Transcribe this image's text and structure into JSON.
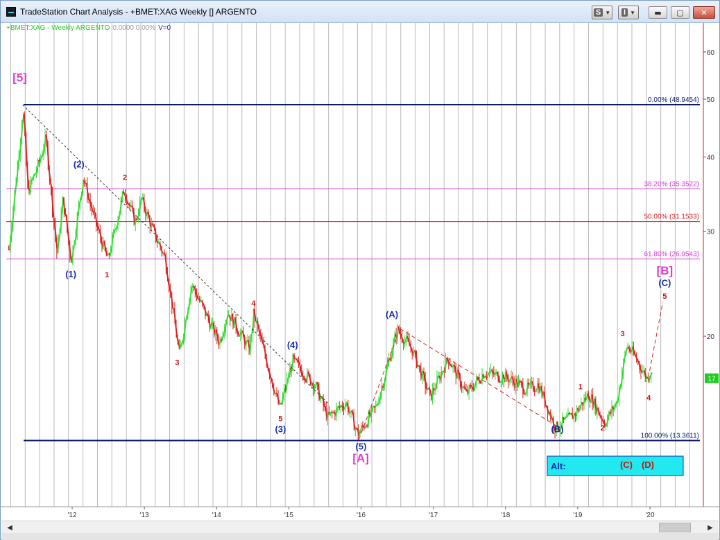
{
  "window": {
    "title": "TradeStation Chart Analysis - +BMET:XAG Weekly [] ARGENTO"
  },
  "toolbar": {
    "s_label": "S",
    "i_label": "I"
  },
  "legend": {
    "symbol": "+BMET:XAG - Weekly  ARGENTO",
    "values": "0.0000  0.00%",
    "volume": "V=0"
  },
  "colors": {
    "up": "#33dd33",
    "down": "#dd2222",
    "fib_dark": "#0a1a6e",
    "fib_magenta": "#d63ad6",
    "fib_red": "#cc2222",
    "wave_blue": "#1a2fa8",
    "wave_red": "#cc1111",
    "wave_pink": "#e03ad0"
  },
  "chart_data": {
    "type": "candlestick",
    "x_ticks": [
      "'12",
      "'13",
      "'14",
      "'15",
      "'16",
      "'17",
      "'18",
      "'19",
      "'20"
    ],
    "y_ticks": [
      60,
      50,
      40,
      30,
      20
    ],
    "y_scale": "log",
    "ylim": [
      11,
      63
    ],
    "last_price": "17",
    "price_path": [
      [
        "2011-02",
        28
      ],
      [
        "2011-04",
        44
      ],
      [
        "2011-04-25",
        48.5
      ],
      [
        "2011-05-20",
        35
      ],
      [
        "2011-07",
        39
      ],
      [
        "2011-08-20",
        43
      ],
      [
        "2011-10",
        27.5
      ],
      [
        "2011-11",
        34
      ],
      [
        "2011-12-25",
        26.7
      ],
      [
        "2012-02-25",
        37
      ],
      [
        "2012-04",
        32
      ],
      [
        "2012-06-28",
        26.8
      ],
      [
        "2012-09-20",
        35.3
      ],
      [
        "2012-11",
        31
      ],
      [
        "2012-12",
        34
      ],
      [
        "2013-02",
        30
      ],
      [
        "2013-04",
        27
      ],
      [
        "2013-06-25",
        18.6
      ],
      [
        "2013-08-25",
        24.5
      ],
      [
        "2014-01",
        19.5
      ],
      [
        "2014-02-25",
        22
      ],
      [
        "2014-06",
        19
      ],
      [
        "2014-07-05",
        21.8
      ],
      [
        "2014-11-15",
        15.1
      ],
      [
        "2015-01-20",
        18.2
      ],
      [
        "2015-05",
        16.5
      ],
      [
        "2015-07",
        14.6
      ],
      [
        "2015-10",
        15.5
      ],
      [
        "2015-12-15",
        13.7
      ],
      [
        "2016-03",
        15.2
      ],
      [
        "2016-07-01",
        20.5
      ],
      [
        "2016-09",
        19
      ],
      [
        "2016-12",
        15.8
      ],
      [
        "2017-03",
        18.4
      ],
      [
        "2017-06",
        16
      ],
      [
        "2017-09",
        17.4
      ],
      [
        "2018-01",
        17
      ],
      [
        "2018-04",
        16.3
      ],
      [
        "2018-06",
        16.6
      ],
      [
        "2018-09-10",
        14
      ],
      [
        "2018-12",
        14.8
      ],
      [
        "2019-02-25",
        16
      ],
      [
        "2019-05-15",
        14.3
      ],
      [
        "2019-07",
        15.5
      ],
      [
        "2019-09-05",
        19.3
      ],
      [
        "2019-10",
        18.5
      ],
      [
        "2019-12",
        17
      ],
      [
        "2020-01-10",
        17.7
      ]
    ],
    "fib_levels": [
      {
        "label": "0.00% (48.9454)",
        "value": 48.9454,
        "color": "#0a1a6e",
        "width": 2
      },
      {
        "label": "38.20% (35.3522)",
        "value": 35.3522,
        "color": "#d63ad6",
        "width": 1
      },
      {
        "label": "50.00% (31.1533)",
        "value": 31.1533,
        "color": "#cc2222",
        "width": 1
      },
      {
        "label": "61.80% (26.9543)",
        "value": 26.9543,
        "color": "#d63ad6",
        "width": 1
      },
      {
        "label": "100.00% (13.3611)",
        "value": 13.3611,
        "color": "#0a1a6e",
        "width": 2
      }
    ],
    "annotations": [
      {
        "text": "[5]",
        "date": "2011-04-10",
        "value": 53.5,
        "color": "#e03ad0",
        "size": 17
      },
      {
        "text": "(2)",
        "date": "2012-02-05",
        "value": 38.4,
        "color": "#1a2fa8",
        "size": 13
      },
      {
        "text": "2",
        "date": "2012-09-25",
        "value": 36.6,
        "color": "#cc1111",
        "size": 11
      },
      {
        "text": "(1)",
        "date": "2011-12-25",
        "value": 25.1,
        "color": "#1a2fa8",
        "size": 13
      },
      {
        "text": "1",
        "date": "2012-06-25",
        "value": 25.1,
        "color": "#cc1111",
        "size": 11
      },
      {
        "text": "3",
        "date": "2013-06-15",
        "value": 17.9,
        "color": "#cc1111",
        "size": 11
      },
      {
        "text": "4",
        "date": "2014-07-05",
        "value": 22.5,
        "color": "#cc1111",
        "size": 11
      },
      {
        "text": "(4)",
        "date": "2015-01-20",
        "value": 19.1,
        "color": "#1a2fa8",
        "size": 13
      },
      {
        "text": "5",
        "date": "2014-11-20",
        "value": 14.4,
        "color": "#cc1111",
        "size": 11
      },
      {
        "text": "(3)",
        "date": "2014-11-20",
        "value": 13.8,
        "color": "#1a2fa8",
        "size": 13
      },
      {
        "text": "(A)",
        "date": "2016-06-05",
        "value": 21.5,
        "color": "#1a2fa8",
        "size": 13
      },
      {
        "text": "(5)",
        "date": "2016-01-01",
        "value": 12.9,
        "color": "#1a2fa8",
        "size": 13
      },
      {
        "text": "[A]",
        "date": "2015-12-30",
        "value": 12.3,
        "color": "#e03ad0",
        "size": 17
      },
      {
        "text": "(B)",
        "date": "2018-09-20",
        "value": 13.8,
        "color": "#1a2fa8",
        "size": 13
      },
      {
        "text": "1",
        "date": "2019-01-15",
        "value": 16.3,
        "color": "#cc1111",
        "size": 11
      },
      {
        "text": "2",
        "date": "2019-05-05",
        "value": 13.9,
        "color": "#cc1111",
        "size": 11
      },
      {
        "text": "3",
        "date": "2019-08-15",
        "value": 20.0,
        "color": "#cc1111",
        "size": 11
      },
      {
        "text": "4",
        "date": "2019-12-25",
        "value": 15.6,
        "color": "#cc1111",
        "size": 11
      },
      {
        "text": "[B]",
        "date": "2020-03-15",
        "value": 25.4,
        "color": "#e03ad0",
        "size": 17
      },
      {
        "text": "(C)",
        "date": "2020-03-15",
        "value": 24.3,
        "color": "#1a2fa8",
        "size": 13
      },
      {
        "text": "5",
        "date": "2020-03-15",
        "value": 23.1,
        "color": "#cc1111",
        "size": 11
      }
    ],
    "trendlines": [
      {
        "from": [
          "2011-04-25",
          48.9
        ],
        "to": [
          "2015-07-20",
          15.4
        ],
        "color": "#333333",
        "dash": "3,3"
      },
      {
        "from": [
          "2016-07-15",
          20.6
        ],
        "to": [
          "2018-10-05",
          14.0
        ],
        "color": "#cc2222",
        "dash": "6,4"
      },
      {
        "from": [
          "2015-12-20",
          13.4
        ],
        "to": [
          "2016-07-01",
          20.0
        ],
        "color": "#cc2222",
        "dash": "6,4"
      },
      {
        "from": [
          "2019-12-30",
          17.5
        ],
        "to": [
          "2020-03-05",
          22.8
        ],
        "color": "#cc2222",
        "dash": "6,4"
      }
    ],
    "alt_box": {
      "label": "Alt:",
      "wave_c": "(C)",
      "wave_d": "(D)"
    }
  }
}
